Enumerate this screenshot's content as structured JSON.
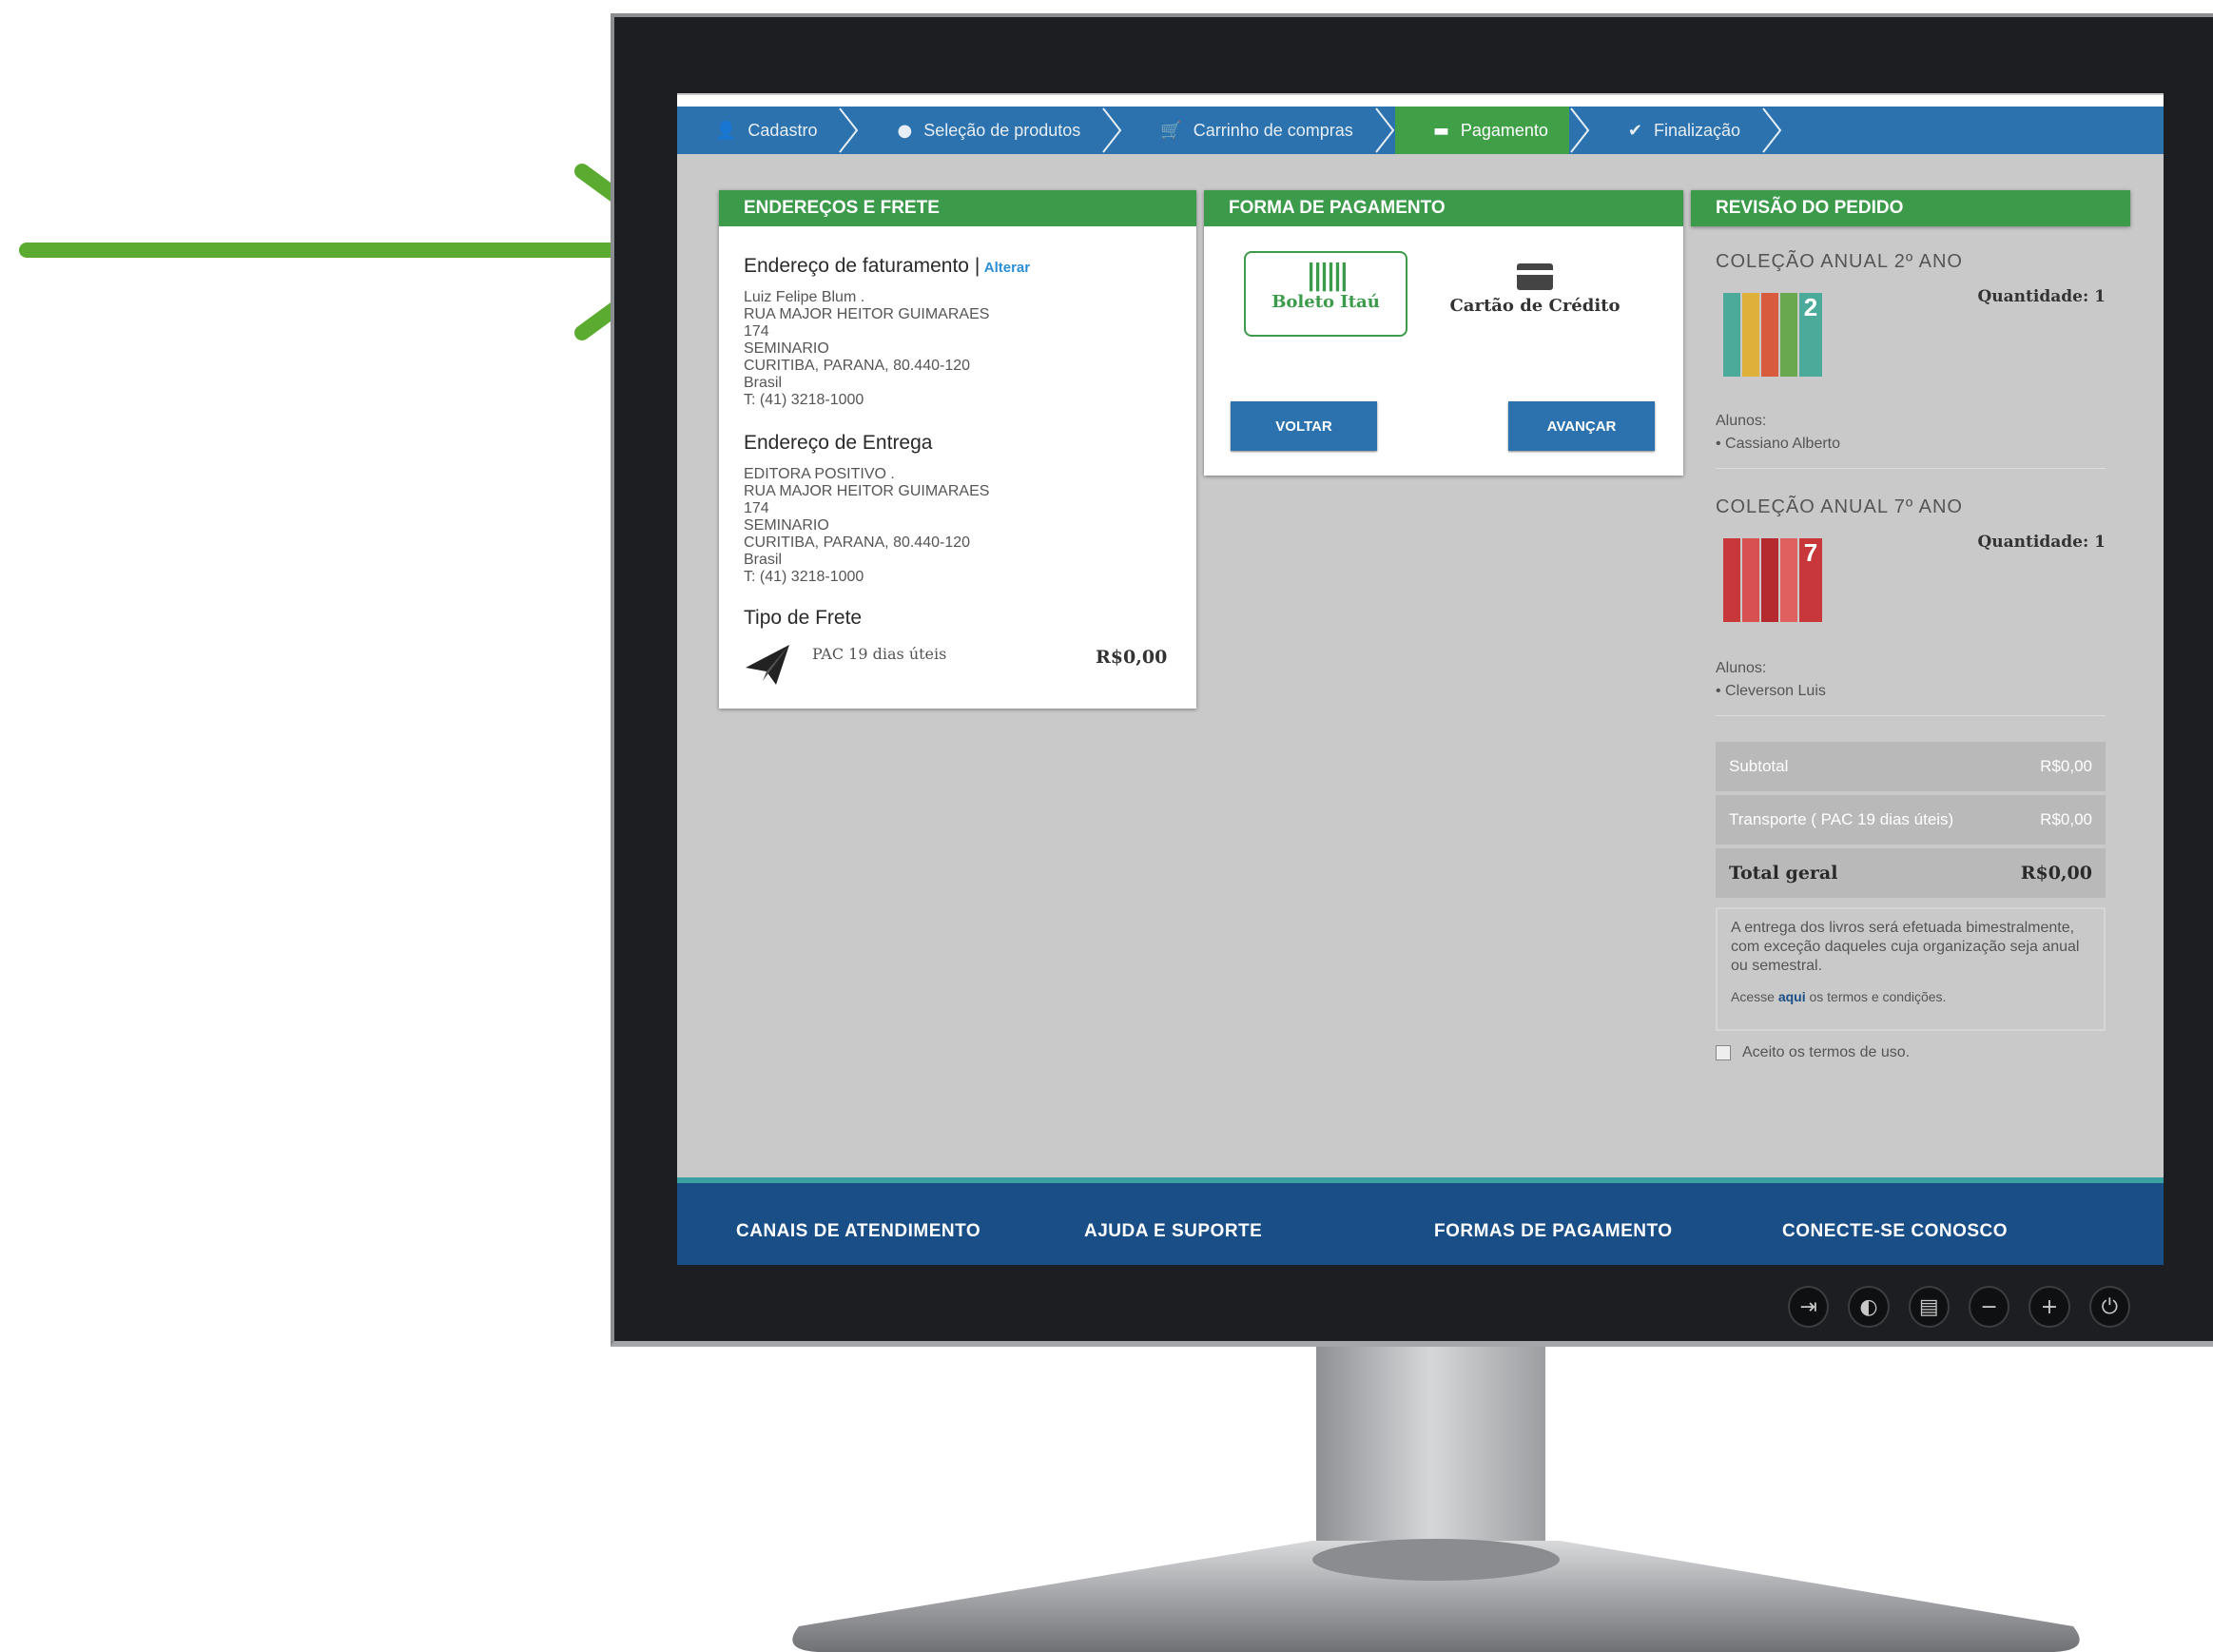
{
  "steps": [
    {
      "label": "Cadastro",
      "icon": "user-icon"
    },
    {
      "label": "Seleção de produtos",
      "icon": "circle-icon"
    },
    {
      "label": "Carrinho de compras",
      "icon": "cart-icon"
    },
    {
      "label": "Pagamento",
      "icon": "card-icon"
    },
    {
      "label": "Finalização",
      "icon": "check-icon"
    }
  ],
  "shipping": {
    "title": "ENDEREÇOS E FRETE",
    "billing_title": "Endereço de faturamento |",
    "billing_change": "Alterar",
    "billing_lines": [
      "Luiz Felipe Blum .",
      "RUA MAJOR HEITOR GUIMARAES",
      "174",
      "SEMINARIO",
      "CURITIBA, PARANA, 80.440-120",
      "Brasil",
      "T: (41) 3218-1000"
    ],
    "delivery_title": "Endereço de Entrega",
    "delivery_lines": [
      "EDITORA POSITIVO .",
      "RUA MAJOR HEITOR GUIMARAES",
      "174",
      "SEMINARIO",
      "CURITIBA, PARANA, 80.440-120",
      "Brasil",
      "T: (41) 3218-1000"
    ],
    "freight_title": "Tipo de Frete",
    "freight_option": "PAC 19 dias úteis",
    "freight_price": "R$0,00"
  },
  "payment": {
    "title": "FORMA DE PAGAMENTO",
    "option_boleto": "Boleto Itaú",
    "option_card": "Cartão de Crédito",
    "back": "VOLTAR",
    "next": "AVANÇAR"
  },
  "review": {
    "title": "REVISÃO DO PEDIDO",
    "items": [
      {
        "name": "COLEÇÃO ANUAL 2º ANO",
        "qty_label": "Quantidade:",
        "qty": "1",
        "students_label": "Alunos:",
        "student": "Cassiano Alberto",
        "cover_number": "2"
      },
      {
        "name": "COLEÇÃO ANUAL 7º ANO",
        "qty_label": "Quantidade:",
        "qty": "1",
        "students_label": "Alunos:",
        "student": "Cleverson Luis",
        "cover_number": "7"
      }
    ],
    "subtotal_label": "Subtotal",
    "subtotal": "R$0,00",
    "transport_label": "Transporte ( PAC 19 dias úteis)",
    "transport": "R$0,00",
    "total_label": "Total geral",
    "total": "R$0,00",
    "note": "A entrega dos livros será efetuada bimestralmente, com exceção daqueles cuja organização seja anual ou semestral.",
    "terms_prefix": "Acesse",
    "terms_link": "aqui",
    "terms_suffix": "os termos e condições.",
    "accept": "Aceito os termos de uso."
  },
  "footer": [
    "CANAIS DE ATENDIMENTO",
    "AJUDA E SUPORTE",
    "FORMAS DE PAGAMENTO",
    "CONECTE-SE CONOSCO"
  ],
  "monitor_buttons": [
    "input-icon",
    "menu-icon",
    "panel-icon",
    "minus-icon",
    "plus-icon",
    "power-icon"
  ],
  "colors": {
    "accent_green": "#3c9a4b",
    "nav_blue": "#2b72ae",
    "footer_blue": "#1a4e86",
    "arrow_green": "#5aab2f"
  }
}
